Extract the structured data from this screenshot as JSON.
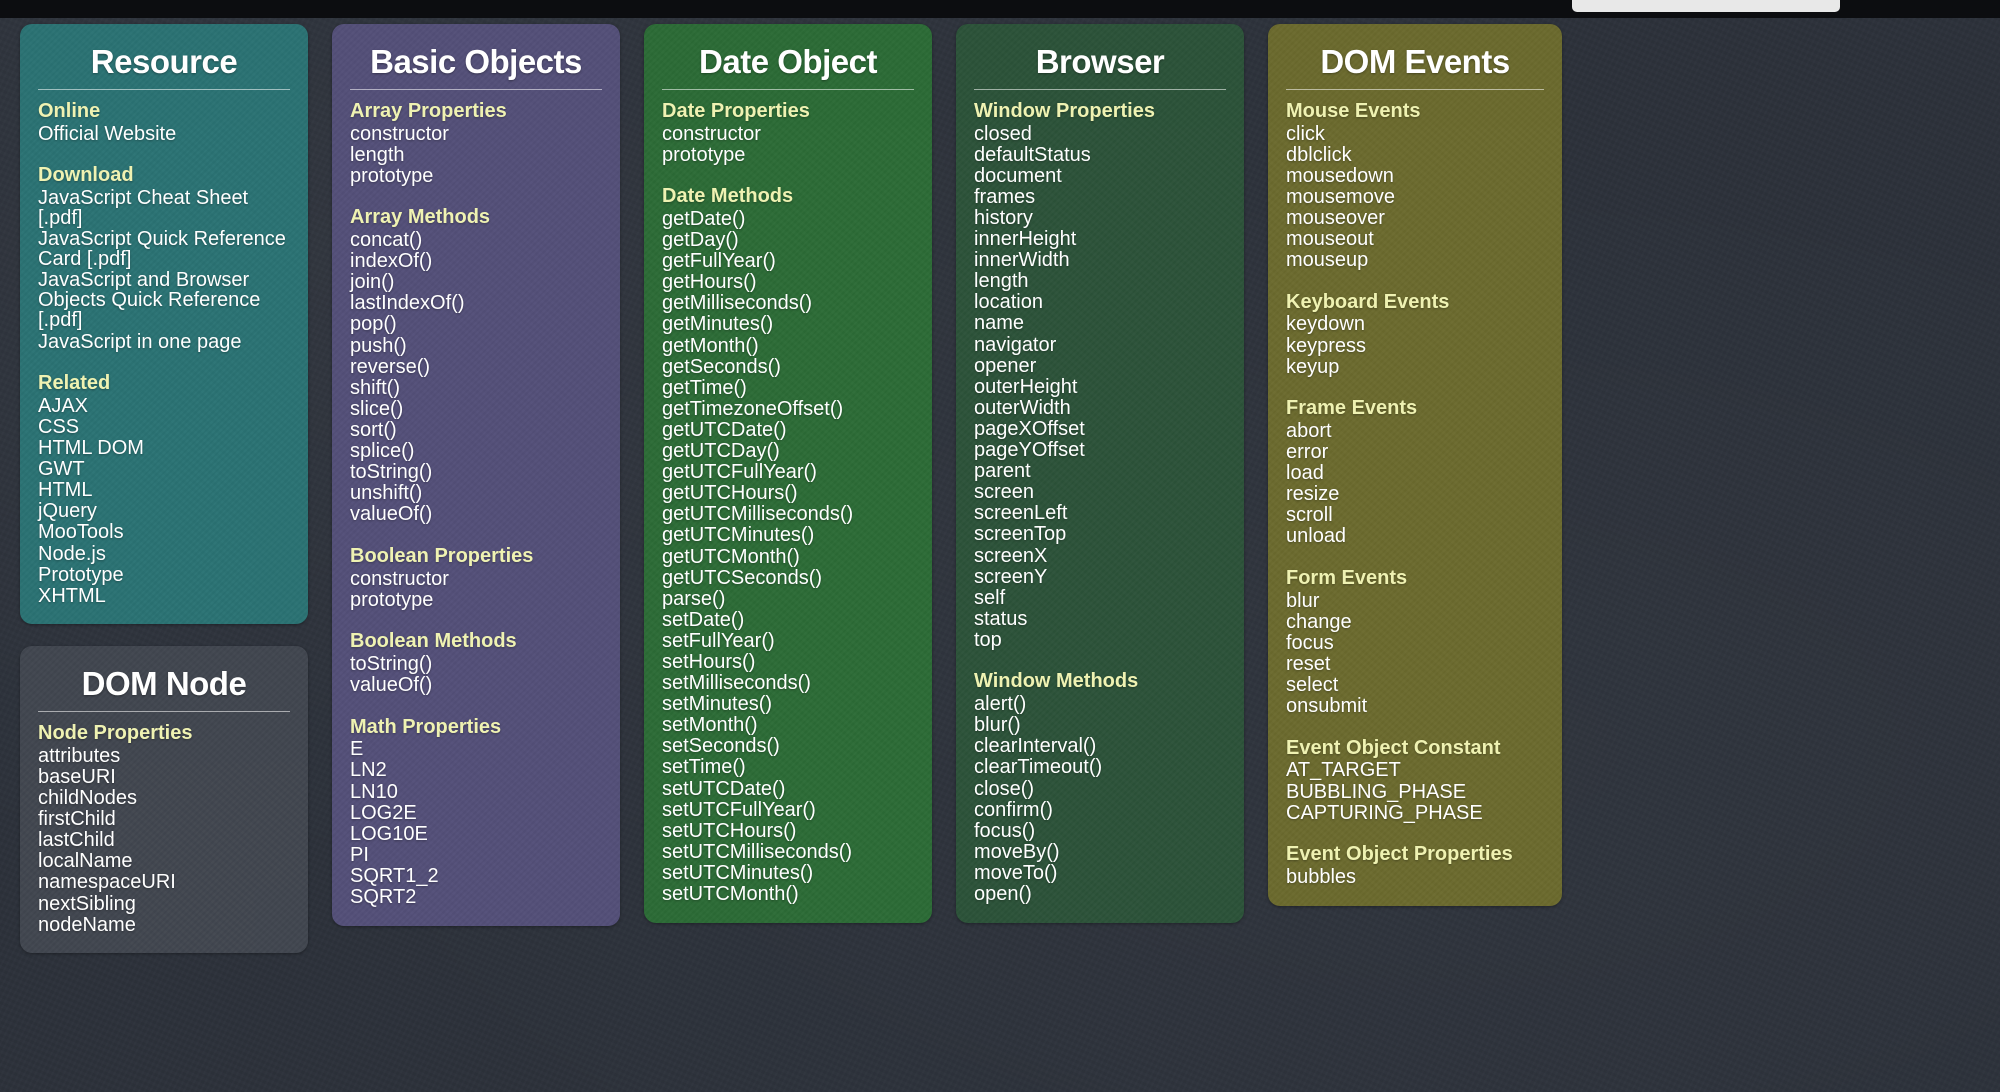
{
  "topbar": {
    "field_value": ""
  },
  "theme": {
    "background": "#2c313a",
    "heading_color": "#eff2b2",
    "text_color": "#ffffff"
  },
  "columns": [
    {
      "id": "column-1",
      "cards": [
        {
          "id": "resource",
          "title": "Resource",
          "color": "#2a7273",
          "theme": "theme-teal",
          "sections": [
            {
              "title": "Online",
              "items": [
                "Official Website"
              ]
            },
            {
              "title": "Download",
              "items": [
                "JavaScript Cheat Sheet [.pdf]",
                "JavaScript Quick Reference Card [.pdf]",
                "JavaScript and Browser Objects Quick Reference [.pdf]",
                "JavaScript in one page"
              ]
            },
            {
              "title": "Related",
              "items": [
                "AJAX",
                "CSS",
                "HTML DOM",
                "GWT",
                "HTML",
                "jQuery",
                "MooTools",
                "Node.js",
                "Prototype",
                "XHTML"
              ]
            }
          ]
        },
        {
          "id": "dom-node",
          "title": "DOM Node",
          "color": "#41464f",
          "theme": "theme-gray",
          "sections": [
            {
              "title": "Node Properties",
              "items": [
                "attributes",
                "baseURI",
                "childNodes",
                "firstChild",
                "lastChild",
                "localName",
                "namespaceURI",
                "nextSibling",
                "nodeName"
              ]
            }
          ]
        }
      ]
    },
    {
      "id": "column-2",
      "cards": [
        {
          "id": "basic-objects",
          "title": "Basic Objects",
          "color": "#534f78",
          "theme": "theme-purple",
          "sections": [
            {
              "title": "Array Properties",
              "items": [
                "constructor",
                "length",
                "prototype"
              ]
            },
            {
              "title": "Array Methods",
              "items": [
                "concat()",
                "indexOf()",
                "join()",
                "lastIndexOf()",
                "pop()",
                "push()",
                "reverse()",
                "shift()",
                "slice()",
                "sort()",
                "splice()",
                "toString()",
                "unshift()",
                "valueOf()"
              ]
            },
            {
              "title": "Boolean Properties",
              "items": [
                "constructor",
                "prototype"
              ]
            },
            {
              "title": "Boolean Methods",
              "items": [
                "toString()",
                "valueOf()"
              ]
            },
            {
              "title": "Math Properties",
              "items": [
                "E",
                "LN2",
                "LN10",
                "LOG2E",
                "LOG10E",
                "PI",
                "SQRT1_2",
                "SQRT2"
              ]
            }
          ]
        }
      ]
    },
    {
      "id": "column-3",
      "cards": [
        {
          "id": "date-object",
          "title": "Date Object",
          "color": "#2c6b36",
          "theme": "theme-green",
          "sections": [
            {
              "title": "Date Properties",
              "items": [
                "constructor",
                "prototype"
              ]
            },
            {
              "title": "Date Methods",
              "items": [
                "getDate()",
                "getDay()",
                "getFullYear()",
                "getHours()",
                "getMilliseconds()",
                "getMinutes()",
                "getMonth()",
                "getSeconds()",
                "getTime()",
                "getTimezoneOffset()",
                "getUTCDate()",
                "getUTCDay()",
                "getUTCFullYear()",
                "getUTCHours()",
                "getUTCMilliseconds()",
                "getUTCMinutes()",
                "getUTCMonth()",
                "getUTCSeconds()",
                "parse()",
                "setDate()",
                "setFullYear()",
                "setHours()",
                "setMilliseconds()",
                "setMinutes()",
                "setMonth()",
                "setSeconds()",
                "setTime()",
                "setUTCDate()",
                "setUTCFullYear()",
                "setUTCHours()",
                "setUTCMilliseconds()",
                "setUTCMinutes()",
                "setUTCMonth()"
              ]
            }
          ]
        }
      ]
    },
    {
      "id": "column-4",
      "cards": [
        {
          "id": "browser",
          "title": "Browser",
          "color": "#2c5239",
          "theme": "theme-dgreen",
          "sections": [
            {
              "title": "Window Properties",
              "items": [
                "closed",
                "defaultStatus",
                "document",
                "frames",
                "history",
                "innerHeight",
                "innerWidth",
                "length",
                "location",
                "name",
                "navigator",
                "opener",
                "outerHeight",
                "outerWidth",
                "pageXOffset",
                "pageYOffset",
                "parent",
                "screen",
                "screenLeft",
                "screenTop",
                "screenX",
                "screenY",
                "self",
                "status",
                "top"
              ]
            },
            {
              "title": "Window Methods",
              "items": [
                "alert()",
                "blur()",
                "clearInterval()",
                "clearTimeout()",
                "close()",
                "confirm()",
                "focus()",
                "moveBy()",
                "moveTo()",
                "open()"
              ]
            }
          ]
        }
      ]
    },
    {
      "id": "column-5",
      "cards": [
        {
          "id": "dom-events",
          "title": "DOM Events",
          "color": "#6b6a2e",
          "theme": "theme-olive",
          "sections": [
            {
              "title": "Mouse Events",
              "items": [
                "click",
                "dblclick",
                "mousedown",
                "mousemove",
                "mouseover",
                "mouseout",
                "mouseup"
              ]
            },
            {
              "title": "Keyboard Events",
              "items": [
                "keydown",
                "keypress",
                "keyup"
              ]
            },
            {
              "title": "Frame Events",
              "items": [
                "abort",
                "error",
                "load",
                "resize",
                "scroll",
                "unload"
              ]
            },
            {
              "title": "Form Events",
              "items": [
                "blur",
                "change",
                "focus",
                "reset",
                "select",
                "onsubmit"
              ]
            },
            {
              "title": "Event Object Constant",
              "items": [
                "AT_TARGET",
                "BUBBLING_PHASE",
                "CAPTURING_PHASE"
              ]
            },
            {
              "title": "Event Object Properties",
              "items": [
                "bubbles"
              ]
            }
          ]
        }
      ]
    }
  ]
}
